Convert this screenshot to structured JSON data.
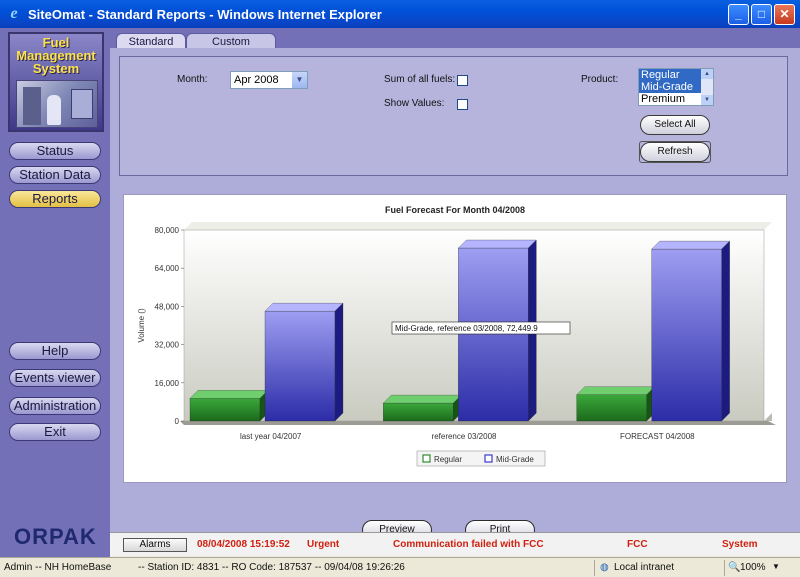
{
  "window": {
    "title": "SiteOmat - Standard Reports - Windows Internet Explorer"
  },
  "logo": {
    "line1": "Fuel",
    "line2": "Management",
    "line3": "System",
    "brand": "ORPAK"
  },
  "sidebar": {
    "top_items": [
      {
        "label": "Status"
      },
      {
        "label": "Station Data"
      },
      {
        "label": "Reports",
        "active": true
      }
    ],
    "bottom_items": [
      {
        "label": "Help"
      },
      {
        "label": "Events viewer"
      },
      {
        "label": "Administration"
      },
      {
        "label": "Exit"
      }
    ]
  },
  "tabs": [
    {
      "label": "Standard",
      "active": true
    },
    {
      "label": "Custom"
    }
  ],
  "filters": {
    "month_label": "Month:",
    "month_value": "Apr 2008",
    "sum_label": "Sum of all fuels:",
    "show_values_label": "Show Values:",
    "product_label": "Product:",
    "product_options": [
      {
        "label": "Regular",
        "selected": true
      },
      {
        "label": "Mid-Grade",
        "selected": true
      },
      {
        "label": "Premium",
        "selected": false
      }
    ],
    "select_all_label": "Select All",
    "refresh_label": "Refresh"
  },
  "chart_data": {
    "type": "bar",
    "title": "Fuel Forecast For Month 04/2008",
    "ylabel": "Volume ()",
    "xlabel": "",
    "categories": [
      "last year 04/2007",
      "reference 03/2008",
      "FORECAST 04/2008"
    ],
    "series": [
      {
        "name": "Regular",
        "color": "#2e8b2e",
        "values": [
          9500,
          7500,
          11000
        ]
      },
      {
        "name": "Mid-Grade",
        "color": "#3a3acc",
        "values": [
          46000,
          72449.9,
          72000
        ]
      }
    ],
    "ylim": [
      0,
      80000
    ],
    "yticks": [
      "0",
      "16,000",
      "32,000",
      "48,000",
      "64,000",
      "80,000"
    ],
    "grid": false,
    "legend": "bottom",
    "tooltip": "Mid-Grade, reference 03/2008, 72,449.9"
  },
  "actions": {
    "preview_label": "Preview",
    "print_label": "Print"
  },
  "alarm": {
    "button_label": "Alarms",
    "timestamp": "08/04/2008 15:19:52",
    "severity": "Urgent",
    "message": "Communication failed with FCC",
    "source": "FCC",
    "category": "System"
  },
  "statusbar": {
    "user": "Admin -- NH HomeBase",
    "info": "-- Station ID: 4831 -- RO Code: 187537 -- 09/04/08  19:26:26",
    "zone": "Local intranet",
    "zoom": "100%"
  }
}
